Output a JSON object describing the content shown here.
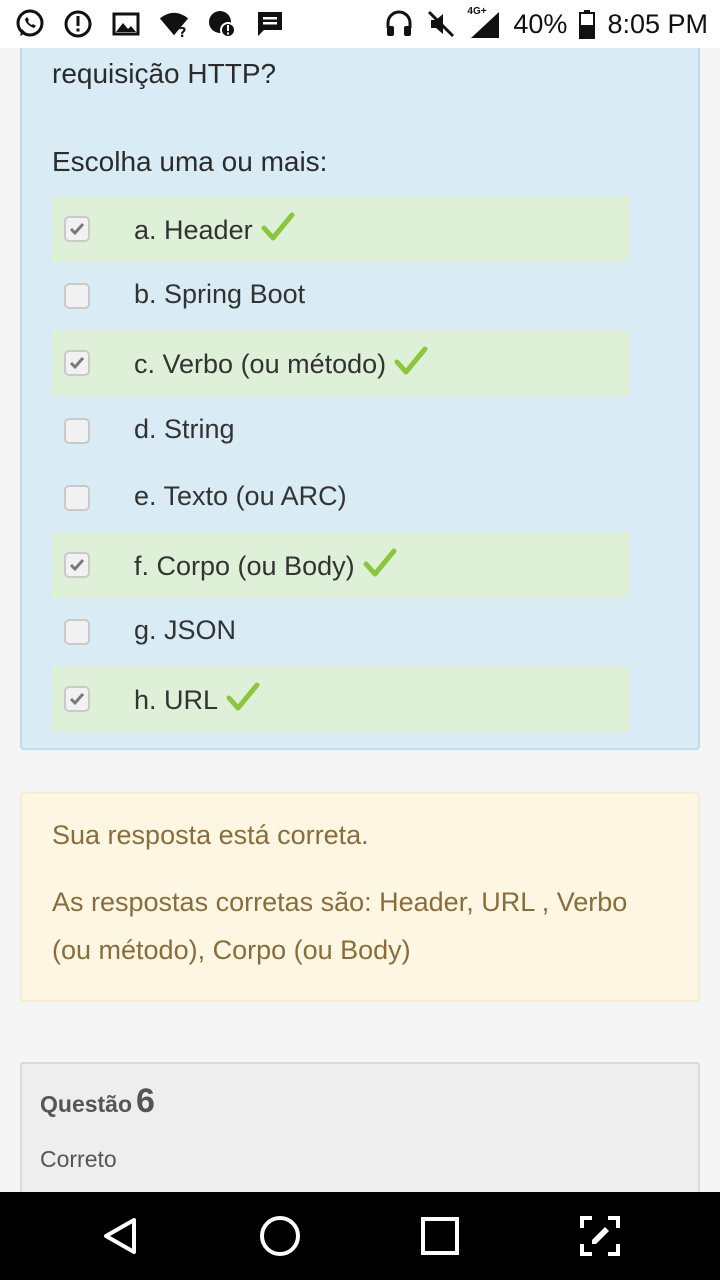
{
  "status_bar": {
    "battery": "40%",
    "time": "8:05 PM",
    "network_badge": "4G+",
    "left_icons": [
      "whatsapp-icon",
      "alert-icon",
      "image-icon",
      "wifi-question-icon",
      "alert-badge-icon",
      "message-icon"
    ],
    "right_icons": [
      "headset-icon",
      "mute-icon",
      "signal-icon",
      "battery-icon"
    ]
  },
  "question": {
    "text_fragment": "requisição HTTP?",
    "prompt": "Escolha uma ou mais:",
    "options": [
      {
        "label": "a. Header",
        "checked": true,
        "correct": true
      },
      {
        "label": "b. Spring Boot",
        "checked": false,
        "correct": false
      },
      {
        "label": "c. Verbo (ou método)",
        "checked": true,
        "correct": true
      },
      {
        "label": "d. String",
        "checked": false,
        "correct": false
      },
      {
        "label": "e. Texto (ou ARC)",
        "checked": false,
        "correct": false
      },
      {
        "label": "f. Corpo (ou Body)",
        "checked": true,
        "correct": true
      },
      {
        "label": "g. JSON",
        "checked": false,
        "correct": false
      },
      {
        "label": "h. URL",
        "checked": true,
        "correct": true
      }
    ]
  },
  "feedback": {
    "result": "Sua resposta está correta.",
    "answers": "As respostas corretas são: Header, URL , Verbo (ou método), Corpo (ou Body)"
  },
  "next_question": {
    "word": "Questão",
    "number": "6",
    "status": "Correto"
  },
  "nav_bar": {
    "buttons": [
      "back-icon",
      "home-icon",
      "recents-icon",
      "screenshot-edit-icon"
    ]
  },
  "colors": {
    "question_bg": "#d9ebf5",
    "correct_bg": "#dff0d8",
    "tick": "#8cc63f",
    "feedback_bg": "#fcf6e3",
    "feedback_text": "#8a6d3b"
  }
}
